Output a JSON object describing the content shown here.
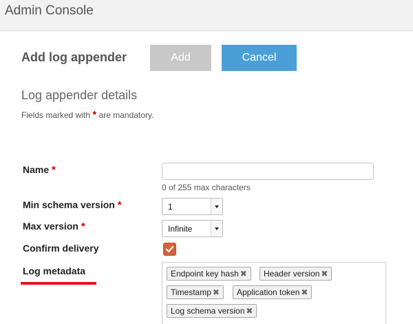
{
  "header": {
    "title": "Admin Console"
  },
  "page": {
    "title": "Add log appender"
  },
  "actions": {
    "add_label": "Add",
    "cancel_label": "Cancel"
  },
  "details": {
    "title": "Log appender details",
    "mandatory_prefix": "Fields marked with",
    "mandatory_star": "*",
    "mandatory_suffix": "are mandatory."
  },
  "form": {
    "name": {
      "label": "Name",
      "required_mark": "*",
      "value": "",
      "counter": "0 of 255 max characters"
    },
    "min_schema_version": {
      "label": "Min schema version",
      "required_mark": "*",
      "selected": "1"
    },
    "max_version": {
      "label": "Max version",
      "required_mark": "*",
      "selected": "Infinite"
    },
    "confirm_delivery": {
      "label": "Confirm delivery",
      "checked": true
    },
    "log_metadata": {
      "label": "Log metadata",
      "tags": [
        "Endpoint key hash",
        "Header version",
        "Timestamp",
        "Application token",
        "Log schema version"
      ],
      "remove_glyph": "✖"
    }
  },
  "colors": {
    "add_button": "#c8c8c8",
    "cancel_button": "#4aa0d6",
    "required_star": "#cc0000",
    "checkbox_checked": "#d3623e",
    "underline": "#e8161e"
  }
}
